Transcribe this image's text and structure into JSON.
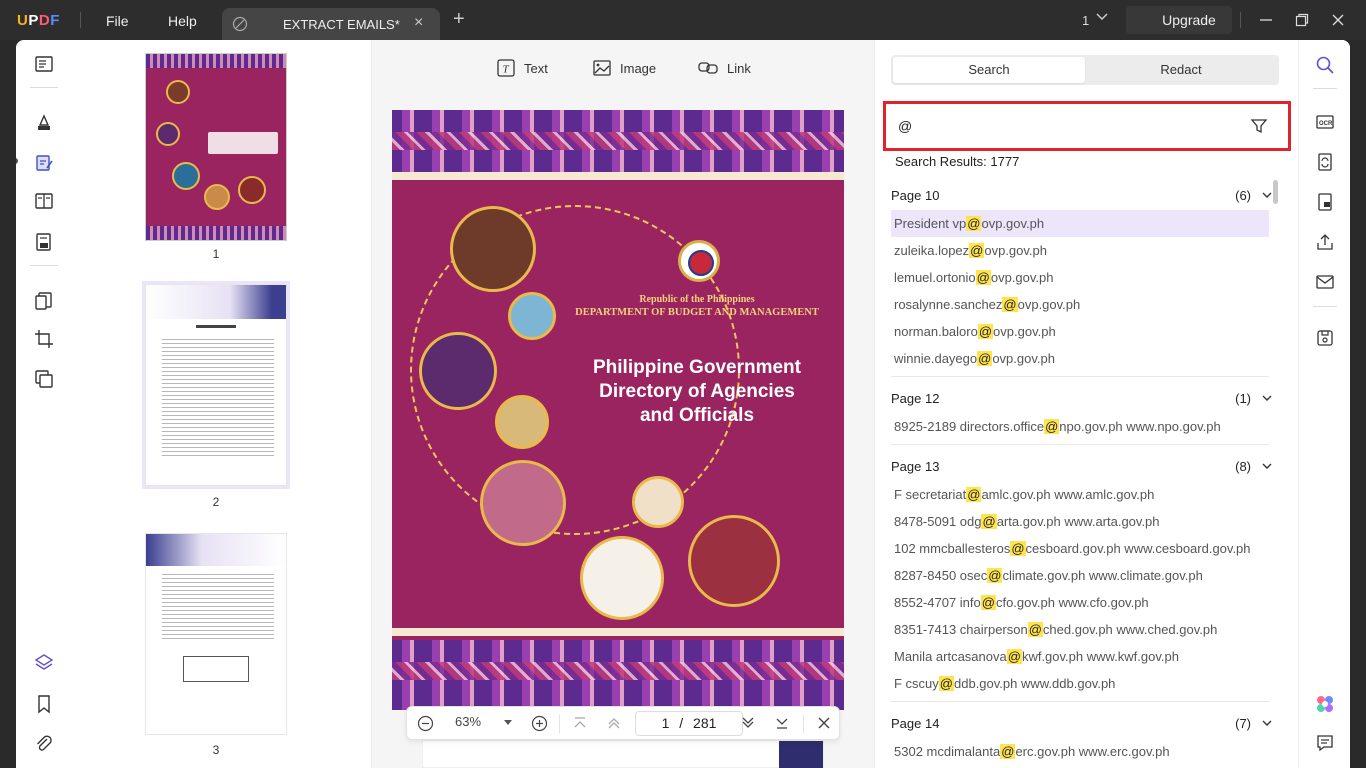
{
  "app": {
    "logo": "UPDF",
    "menu": {
      "file": "File",
      "help": "Help"
    },
    "tab_title": "EXTRACT EMAILS*",
    "tab_count": "1",
    "upgrade": "Upgrade"
  },
  "doc_tools": {
    "text": "Text",
    "image": "Image",
    "link": "Link"
  },
  "thumbnails": [
    {
      "label": "1"
    },
    {
      "label": "2"
    },
    {
      "label": "3"
    }
  ],
  "cover": {
    "republic": "Republic of the Philippines",
    "department": "DEPARTMENT OF BUDGET AND MANAGEMENT",
    "title_line1": "Philippine Government",
    "title_line2": "Directory of Agencies",
    "title_line3": "and Officials"
  },
  "nav": {
    "zoom": "63%",
    "current_page": "1",
    "separator": "/",
    "total_pages": "281"
  },
  "search_panel": {
    "tab_search": "Search",
    "tab_redact": "Redact",
    "query": "@",
    "results_label": "Search Results: 1777",
    "groups": [
      {
        "title": "Page 10",
        "count": "(6)",
        "items": [
          {
            "before": "President vp",
            "match": "@",
            "after": "ovp.gov.ph"
          },
          {
            "before": "zuleika.lopez",
            "match": "@",
            "after": "ovp.gov.ph"
          },
          {
            "before": "lemuel.ortonio",
            "match": "@",
            "after": "ovp.gov.ph"
          },
          {
            "before": "rosalynne.sanchez",
            "match": "@",
            "after": "ovp.gov.ph"
          },
          {
            "before": "norman.baloro",
            "match": "@",
            "after": "ovp.gov.ph"
          },
          {
            "before": "winnie.dayego",
            "match": "@",
            "after": "ovp.gov.ph"
          }
        ]
      },
      {
        "title": "Page 12",
        "count": "(1)",
        "items": [
          {
            "before": "8925-2189 directors.office",
            "match": "@",
            "after": "npo.gov.ph www.npo.gov.ph"
          }
        ]
      },
      {
        "title": "Page 13",
        "count": "(8)",
        "items": [
          {
            "before": "F secretariat",
            "match": "@",
            "after": "amlc.gov.ph www.amlc.gov.ph"
          },
          {
            "before": "8478-5091 odg",
            "match": "@",
            "after": "arta.gov.ph www.arta.gov.ph"
          },
          {
            "before": "102 mmcballesteros",
            "match": "@",
            "after": "cesboard.gov.ph www.cesboard.gov.ph"
          },
          {
            "before": "8287-8450 osec",
            "match": "@",
            "after": "climate.gov.ph www.climate.gov.ph"
          },
          {
            "before": "8552-4707 info",
            "match": "@",
            "after": "cfo.gov.ph www.cfo.gov.ph"
          },
          {
            "before": "8351-7413 chairperson",
            "match": "@",
            "after": "ched.gov.ph www.ched.gov.ph"
          },
          {
            "before": "Manila artcasanova",
            "match": "@",
            "after": "kwf.gov.ph www.kwf.gov.ph"
          },
          {
            "before": "F cscuy",
            "match": "@",
            "after": "ddb.gov.ph www.ddb.gov.ph"
          }
        ]
      },
      {
        "title": "Page 14",
        "count": "(7)",
        "items": [
          {
            "before": "5302 mcdimalanta",
            "match": "@",
            "after": "erc.gov.ph www.erc.gov.ph"
          }
        ]
      }
    ]
  },
  "colors": {
    "accent": "#7b5cd6",
    "search_border": "#e0242f",
    "match_highlight": "#ffe44d",
    "selected_row": "#ede6fb",
    "cover_bg": "#9a2460"
  }
}
